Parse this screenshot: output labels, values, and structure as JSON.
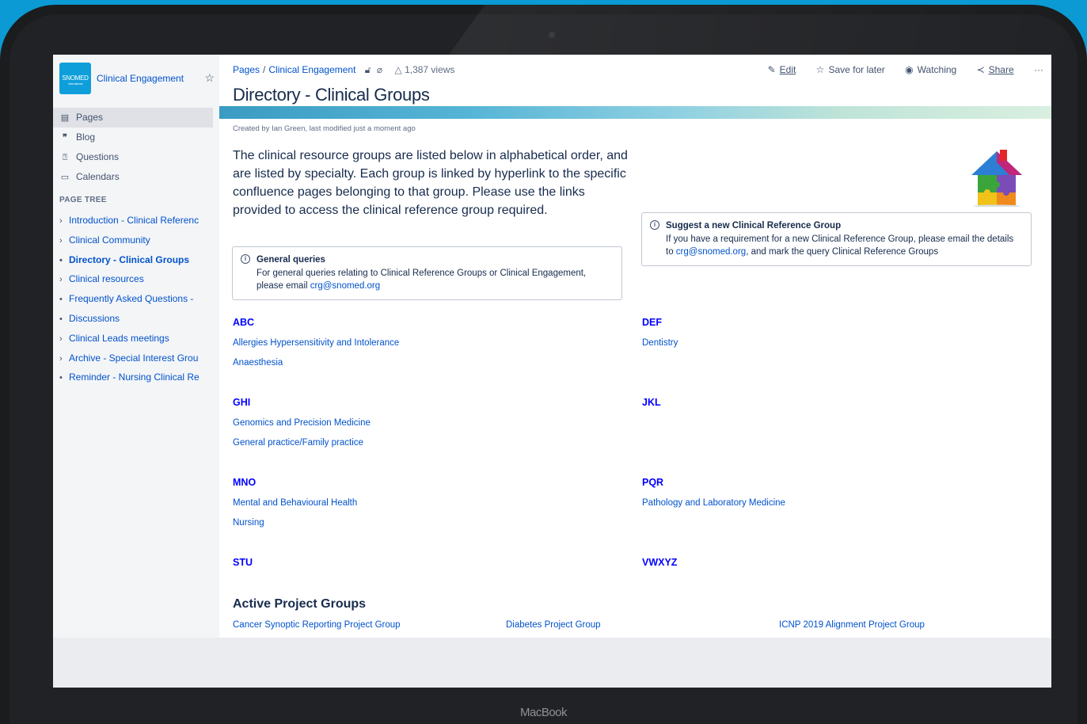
{
  "device": {
    "brand": "MacBook"
  },
  "sidebar": {
    "logo_text": "SNOMED",
    "logo_subtext": "International",
    "space_name": "Clinical Engagement",
    "nav": [
      {
        "icon": "pages-icon",
        "label": "Pages"
      },
      {
        "icon": "blog-icon",
        "label": "Blog"
      },
      {
        "icon": "questions-icon",
        "label": "Questions"
      },
      {
        "icon": "calendar-icon",
        "label": "Calendars"
      }
    ],
    "tree_label": "PAGE TREE",
    "tree": [
      {
        "marker": "chevron",
        "label": "Introduction - Clinical Referenc"
      },
      {
        "marker": "chevron",
        "label": "Clinical Community"
      },
      {
        "marker": "bullet",
        "label": "Directory - Clinical Groups"
      },
      {
        "marker": "chevron",
        "label": "Clinical resources"
      },
      {
        "marker": "bullet",
        "label": "Frequently Asked Questions -"
      },
      {
        "marker": "bullet",
        "label": "Discussions"
      },
      {
        "marker": "chevron",
        "label": "Clinical Leads meetings"
      },
      {
        "marker": "chevron",
        "label": "Archive - Special Interest Grou"
      },
      {
        "marker": "bullet",
        "label": "Reminder - Nursing Clinical Re"
      }
    ]
  },
  "header": {
    "breadcrumb": [
      "Pages",
      "Clinical Engagement"
    ],
    "views": "1,387 views",
    "actions": {
      "edit": "Edit",
      "save": "Save for later",
      "watching": "Watching",
      "share": "Share",
      "more": "···"
    }
  },
  "page": {
    "title": "Directory - Clinical Groups",
    "byline": "Created by Ian Green, last modified just a moment ago",
    "intro": "The clinical resource groups are listed below in alphabetical order, and are listed by specialty. Each group is linked by hyperlink to the specific confluence pages belonging to that group. Please use the links provided to access the clinical reference group required.",
    "general_panel": {
      "title": "General queries",
      "text": "For general queries relating to Clinical Reference Groups or Clinical Engagement, please email",
      "email": "crg@snomed.org"
    },
    "suggest_panel": {
      "title": "Suggest a new Clinical Reference Group",
      "text_before": "If you have a requirement for a new Clinical Reference Group, please email the details to",
      "email": "crg@snomed.org",
      "text_after": ", and mark the query Clinical Reference Groups"
    },
    "groups": [
      {
        "heading": "ABC",
        "links": [
          "Allergies Hypersensitivity and Intolerance",
          "Anaesthesia"
        ]
      },
      {
        "heading": "DEF",
        "links": [
          "Dentistry"
        ]
      },
      {
        "heading": "GHI",
        "links": [
          "Genomics and Precision Medicine",
          "General practice/Family practice"
        ]
      },
      {
        "heading": "JKL",
        "links": []
      },
      {
        "heading": "MNO",
        "links": [
          "Mental and Behavioural Health",
          "Nursing"
        ]
      },
      {
        "heading": "PQR",
        "links": [
          "Pathology and Laboratory Medicine"
        ]
      },
      {
        "heading": "STU",
        "links": []
      },
      {
        "heading": "VWXYZ",
        "links": []
      }
    ],
    "projects_title": "Active Project Groups",
    "projects": [
      "Cancer Synoptic Reporting Project Group",
      "Diabetes Project Group",
      "ICNP 2019 Alignment Project Group"
    ]
  }
}
